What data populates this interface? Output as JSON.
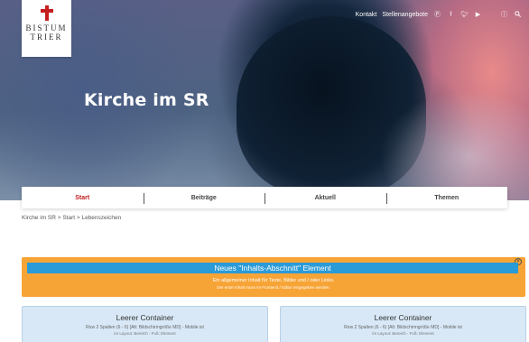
{
  "logo": {
    "line1": "BISTUM",
    "line2": "TRIER",
    "cross_color": "#c41e1e"
  },
  "topbar": {
    "links": [
      "Kontakt",
      "Stellenangebote"
    ],
    "icons": [
      "pinterest-icon",
      "facebook-icon",
      "twitter-icon",
      "youtube-icon",
      "accessibility-icon",
      "search-icon"
    ]
  },
  "hero": {
    "title": "Kirche im SR"
  },
  "nav": {
    "items": [
      "Start",
      "Beiträge",
      "Aktuell",
      "Themen"
    ],
    "active": "Start",
    "active_color": "#c41e1e"
  },
  "breadcrumb": "Kirche im SR > Start > Lebenszeichen",
  "new_section": {
    "title": "Neues \"Inhalts-Abschnitt\" Element",
    "line1": "Ein allgemeiner Inhalt für Texte, Bilder und / oder Links.",
    "line2": "Der erste Inhalt muss im Frontend / Editor eingegeben werden.",
    "bg_color": "#f7a436",
    "head_color": "#2b9bd8"
  },
  "containers": [
    {
      "title": "Leerer Container",
      "sub": "Row 2 Spalten (6 - 6) [Alt: Bildschirmgröße MD] - Mobile ist",
      "sub2": "im Layout: Bereich - Fuß: Element"
    },
    {
      "title": "Leerer Container",
      "sub": "Row 2 Spalten (6 - 6) [Alt: Bildschirmgröße MD] - Mobile ist",
      "sub2": "im Layout: Bereich - Fuß: Element"
    }
  ]
}
